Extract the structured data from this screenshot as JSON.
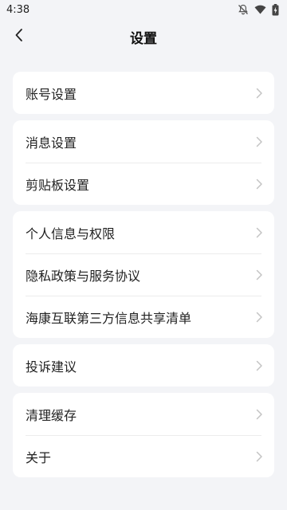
{
  "status_bar": {
    "time": "4:38",
    "icons": [
      "notifications-off-icon",
      "wifi-icon",
      "battery-charging-icon"
    ]
  },
  "header": {
    "title": "设置",
    "back_icon": "chevron-left-icon"
  },
  "groups": [
    {
      "items": [
        {
          "label": "账号设置"
        }
      ]
    },
    {
      "items": [
        {
          "label": "消息设置"
        },
        {
          "label": "剪贴板设置"
        }
      ]
    },
    {
      "items": [
        {
          "label": "个人信息与权限"
        },
        {
          "label": "隐私政策与服务协议"
        },
        {
          "label": "海康互联第三方信息共享清单"
        }
      ]
    },
    {
      "items": [
        {
          "label": "投诉建议"
        }
      ]
    },
    {
      "items": [
        {
          "label": "清理缓存"
        },
        {
          "label": "关于"
        }
      ]
    }
  ],
  "colors": {
    "background": "#f3f4f7",
    "card": "#ffffff",
    "chevron": "#c4c4c4",
    "divider": "#ececec"
  }
}
